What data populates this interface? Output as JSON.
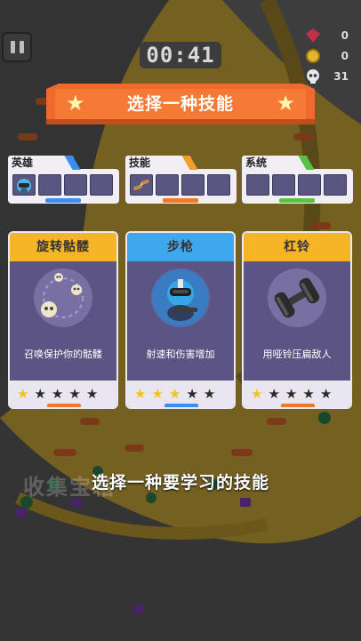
{
  "hud": {
    "timer": "00:41",
    "resources": [
      {
        "name": "gem",
        "value": "0",
        "color": "#c0304a"
      },
      {
        "name": "coin",
        "value": "0",
        "color": "#e3b52b"
      },
      {
        "name": "skull",
        "value": "31",
        "color": "#e8e8e8"
      }
    ]
  },
  "banner": {
    "title": "选择一种技能"
  },
  "slot_panels": [
    {
      "label": "英雄",
      "stripe": "#3d8df0",
      "bar": "#3d8df0"
    },
    {
      "label": "技能",
      "stripe": "#f0a02a",
      "bar": "#f0782a"
    },
    {
      "label": "系统",
      "stripe": "#59c245",
      "bar": "#59c245"
    }
  ],
  "cards": [
    {
      "title": "旋转骷髅",
      "header_color": "#f6b526",
      "desc": "召唤保护你的骷髅",
      "rating": 1,
      "max": 5,
      "notch": "#f0782a"
    },
    {
      "title": "步枪",
      "header_color": "#3fa7ee",
      "desc": "射速和伤害增加",
      "rating": 3,
      "max": 5,
      "notch": "#3d8df0"
    },
    {
      "title": "杠铃",
      "header_color": "#f6b526",
      "desc": "用哑铃压扁敌人",
      "rating": 1,
      "max": 5,
      "notch": "#f0782a"
    }
  ],
  "subtitle": "选择一种要学习的技能",
  "background_text": "收集宝箱"
}
